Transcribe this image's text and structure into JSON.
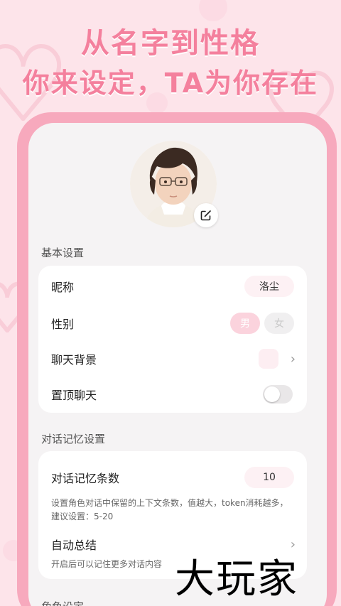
{
  "headline": {
    "line1": "从名字到性格",
    "line2": "你来设定，TA为你存在"
  },
  "basic_settings": {
    "title": "基本设置",
    "nickname_label": "昵称",
    "nickname_value": "洛尘",
    "gender_label": "性别",
    "gender_male": "男",
    "gender_female": "女",
    "chat_bg_label": "聊天背景",
    "pin_label": "置顶聊天"
  },
  "memory_settings": {
    "title": "对话记忆设置",
    "memory_count_label": "对话记忆条数",
    "memory_count_value": "10",
    "memory_desc_line1": "设置角色对话中保留的上下文条数，值越大，token消耗越多，",
    "memory_desc_line2": "建议设置：5-20",
    "auto_summary_label": "自动总结",
    "auto_summary_desc": "开启后可以记住更多对话内容"
  },
  "next_section": {
    "title_partial": "角色设定"
  },
  "watermark": {
    "text": "大玩家"
  },
  "colors": {
    "accent_pink": "#f4809d",
    "frame_pink": "#f7a9bd",
    "selected_pill": "#fbd3dd"
  },
  "icons": {
    "edit": "edit-square-icon",
    "chevron": "chevron-right-icon"
  }
}
